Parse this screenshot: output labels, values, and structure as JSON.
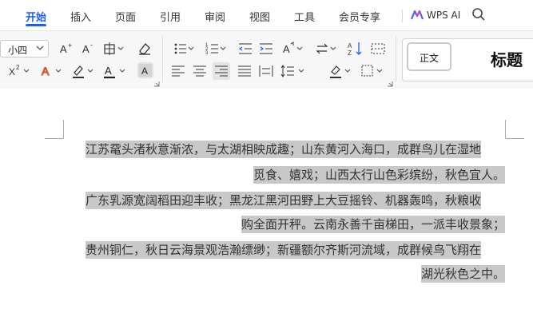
{
  "tabs": [
    {
      "label": "开始",
      "active": true
    },
    {
      "label": "插入"
    },
    {
      "label": "页面"
    },
    {
      "label": "引用"
    },
    {
      "label": "审阅"
    },
    {
      "label": "视图"
    },
    {
      "label": "工具"
    },
    {
      "label": "会员专享"
    }
  ],
  "wps_ai": {
    "label": "WPS AI"
  },
  "ribbon": {
    "font_size": "小四",
    "styles": {
      "normal": "正文",
      "title": "标题"
    }
  },
  "document": {
    "lines": [
      "江苏鼋头渚秋意渐浓，与太湖相映成趣；山东黄河入海口，成群鸟儿在湿地",
      "觅食、嬉戏；山西太行山色彩缤纷，秋色宜人。",
      "广东乳源宽阔稻田迎丰收；黑龙江黑河田野上大豆摇铃、机器轰鸣，秋粮收",
      "购全面开秤。云南永善千亩梯田，一派丰收景象；",
      "贵州铜仁，秋日云海景观浩瀚缥缈；新疆额尔齐斯河流域，成群候鸟飞翔在",
      "湖光秋色之中。"
    ]
  },
  "colors": {
    "accent": "#1a5ff5",
    "selection": "#c8c8c8"
  }
}
